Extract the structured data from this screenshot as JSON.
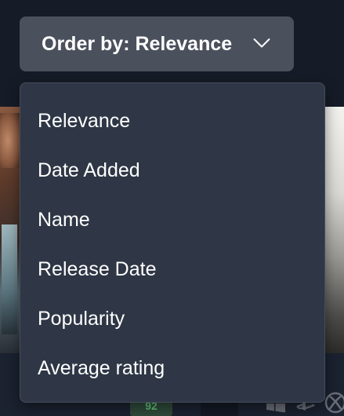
{
  "order_button": {
    "label": "Order by: Relevance",
    "icon": "chevron-down-icon"
  },
  "menu": {
    "items": [
      {
        "label": "Relevance"
      },
      {
        "label": "Date Added"
      },
      {
        "label": "Name"
      },
      {
        "label": "Release Date"
      },
      {
        "label": "Popularity"
      },
      {
        "label": "Average rating"
      }
    ]
  },
  "background": {
    "score": "92",
    "platform_icons": [
      "windows-icon",
      "playstation-icon",
      "xbox-icon"
    ]
  },
  "colors": {
    "page_bg": "#161c27",
    "button_bg": "#4a505c",
    "menu_bg": "#2f3746",
    "text": "#ffffff",
    "score_green": "#5fc07a"
  }
}
